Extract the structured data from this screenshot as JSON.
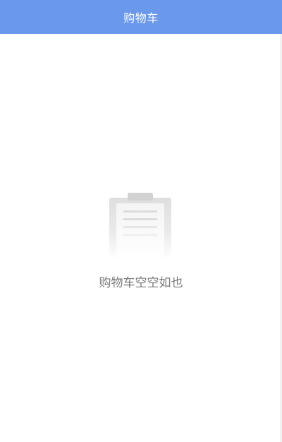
{
  "header": {
    "title": "购物车"
  },
  "cart": {
    "empty_message": "购物车空空如也",
    "empty_icon": "clipboard-icon"
  },
  "colors": {
    "header_bg": "#6a98ea",
    "header_text": "#ffffff",
    "empty_text": "#7a7a7a"
  }
}
